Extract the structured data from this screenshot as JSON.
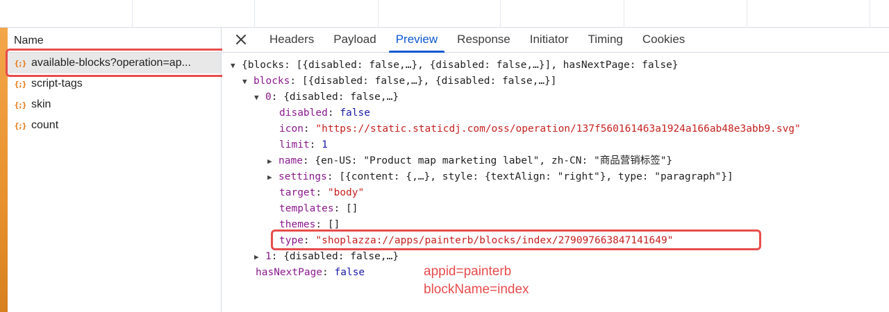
{
  "name_panel": {
    "header": "Name",
    "items": [
      {
        "icon": "{;}",
        "label": "available-blocks?operation=ap..."
      },
      {
        "icon": "{;}",
        "label": "script-tags"
      },
      {
        "icon": "{;}",
        "label": "skin"
      },
      {
        "icon": "{;}",
        "label": "count"
      }
    ]
  },
  "tabs": [
    "Headers",
    "Payload",
    "Preview",
    "Response",
    "Initiator",
    "Timing",
    "Cookies"
  ],
  "active_tab": "Preview",
  "preview": {
    "root_summary": "{blocks: [{disabled: false,…}, {disabled: false,…}], hasNextPage: false}",
    "blocks_key": "blocks",
    "blocks_summary": "[{disabled: false,…}, {disabled: false,…}]",
    "item0_key": "0",
    "item0_summary": "{disabled: false,…}",
    "disabled_key": "disabled",
    "disabled_val": "false",
    "icon_key": "icon",
    "icon_val": "\"https://static.staticdj.com/oss/operation/137f560161463a1924a166ab48e3abb9.svg\"",
    "limit_key": "limit",
    "limit_val": "1",
    "name_key": "name",
    "name_val": "{en-US: \"Product map marketing label\", zh-CN: \"商品营销标签\"}",
    "settings_key": "settings",
    "settings_val": "[{content: {,…}, style: {textAlign: \"right\"}, type: \"paragraph\"}]",
    "target_key": "target",
    "target_val": "\"body\"",
    "templates_key": "templates",
    "templates_val": "[]",
    "themes_key": "themes",
    "themes_val": "[]",
    "type_key": "type",
    "type_val": "\"shoplazza://apps/painterb/blocks/index/279097663847141649\"",
    "item1_key": "1",
    "item1_summary": "{disabled: false,…}",
    "hasNextPage_key": "hasNextPage",
    "hasNextPage_val": "false"
  },
  "annotations": {
    "line1": "appid=painterb",
    "line2": "blockName=index"
  },
  "colors": {
    "accent": "#0b57d0",
    "highlight": "#e74c4c",
    "key": "#8a1a8d",
    "string": "#c5221f",
    "number": "#1a1aa6"
  }
}
